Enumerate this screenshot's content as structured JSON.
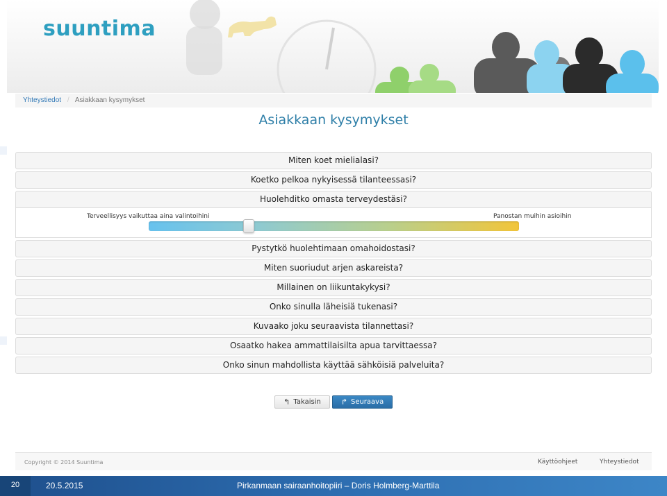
{
  "brand": {
    "logo_text": "suuntima"
  },
  "breadcrumb": {
    "home": "Yhteystiedot",
    "separator": "/",
    "current": "Asiakkaan kysymykset"
  },
  "page": {
    "title": "Asiakkaan kysymykset"
  },
  "questions": [
    "Miten koet mielialasi?",
    "Koetko pelkoa nykyisessä tilanteessasi?",
    "Huolehditko omasta terveydestäsi?",
    "Pystytkö huolehtimaan omahoidostasi?",
    "Miten suoriudut arjen askareista?",
    "Millainen on liikuntakykysi?",
    "Onko sinulla läheisiä tukenasi?",
    "Kuvaako joku seuraavista tilannettasi?",
    "Osaatko hakea ammattilaisilta apua tarvittaessa?",
    "Onko sinun mahdollista käyttää sähköisiä palveluita?"
  ],
  "slider": {
    "left_label": "Terveellisyys vaikuttaa aina valintoihini",
    "right_label": "Panostan muihin asioihin",
    "value_fraction": 0.27,
    "gradient_colors": [
      "#67c2ee",
      "#b9cf8c",
      "#f2c53a"
    ]
  },
  "buttons": {
    "back_label": "Takaisin",
    "next_label": "Seuraava"
  },
  "footer": {
    "copyright": "Copyright © 2014 Suuntima",
    "link_help": "Käyttöohjeet",
    "link_contact": "Yhteystiedot"
  },
  "slide_footer": {
    "number": "20",
    "date": "20.5.2015",
    "author": "Pirkanmaan sairaanhoitopiiri – Doris Holmberg-Marttila"
  },
  "colors": {
    "accent": "#2e9fc0",
    "title": "#2f7fa8",
    "primary_button": "#2a6da6",
    "slide_bar": "#2d6db0"
  }
}
